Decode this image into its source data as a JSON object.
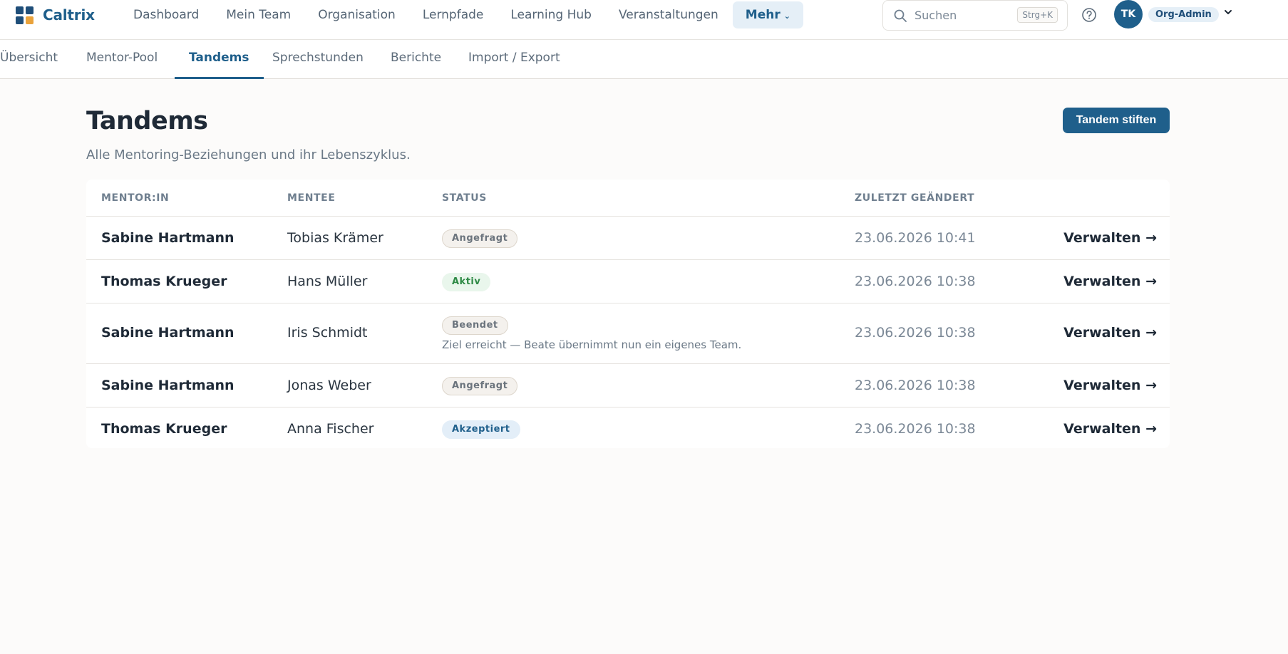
{
  "app": {
    "name": "Caltrix"
  },
  "mainnav": {
    "items": [
      "Dashboard",
      "Mein Team",
      "Organisation",
      "Lernpfade",
      "Learning Hub",
      "Veranstaltungen"
    ],
    "more_label": "Mehr"
  },
  "search": {
    "placeholder": "Suchen",
    "shortcut": "Strg+K"
  },
  "user": {
    "initials": "TK",
    "role": "Org-Admin"
  },
  "subtabs": {
    "items": [
      "Übersicht",
      "Mentor-Pool",
      "Tandems",
      "Sprechstunden",
      "Berichte",
      "Import / Export"
    ],
    "active": "Tandems"
  },
  "page": {
    "title": "Tandems",
    "subtitle": "Alle Mentoring-Beziehungen und ihr Lebenszyklus.",
    "primary_action": "Tandem stiften"
  },
  "table": {
    "columns": [
      "MENTOR:IN",
      "MENTEE",
      "STATUS",
      "ZULETZT GEÄNDERT"
    ],
    "rows": [
      {
        "mentor": "Sabine Hartmann",
        "mentee": "Tobias Krämer",
        "status": "Angefragt",
        "status_color": "gray",
        "note": "",
        "updated": "23.06.2026 10:41",
        "action": "Verwalten →"
      },
      {
        "mentor": "Thomas Krueger",
        "mentee": "Hans Müller",
        "status": "Aktiv",
        "status_color": "green",
        "note": "",
        "updated": "23.06.2026 10:38",
        "action": "Verwalten →"
      },
      {
        "mentor": "Sabine Hartmann",
        "mentee": "Iris Schmidt",
        "status": "Beendet",
        "status_color": "gray",
        "note": "Ziel erreicht — Beate übernimmt nun ein eigenes Team.",
        "updated": "23.06.2026 10:38",
        "action": "Verwalten →"
      },
      {
        "mentor": "Sabine Hartmann",
        "mentee": "Jonas Weber",
        "status": "Angefragt",
        "status_color": "gray",
        "note": "",
        "updated": "23.06.2026 10:38",
        "action": "Verwalten →"
      },
      {
        "mentor": "Thomas Krueger",
        "mentee": "Anna Fischer",
        "status": "Akzeptiert",
        "status_color": "blue",
        "note": "",
        "updated": "23.06.2026 10:38",
        "action": "Verwalten →"
      }
    ]
  },
  "colors": {
    "accent": "#1f5f8b",
    "logo_orange": "#e9a23b",
    "background": "#fcfbfa"
  }
}
